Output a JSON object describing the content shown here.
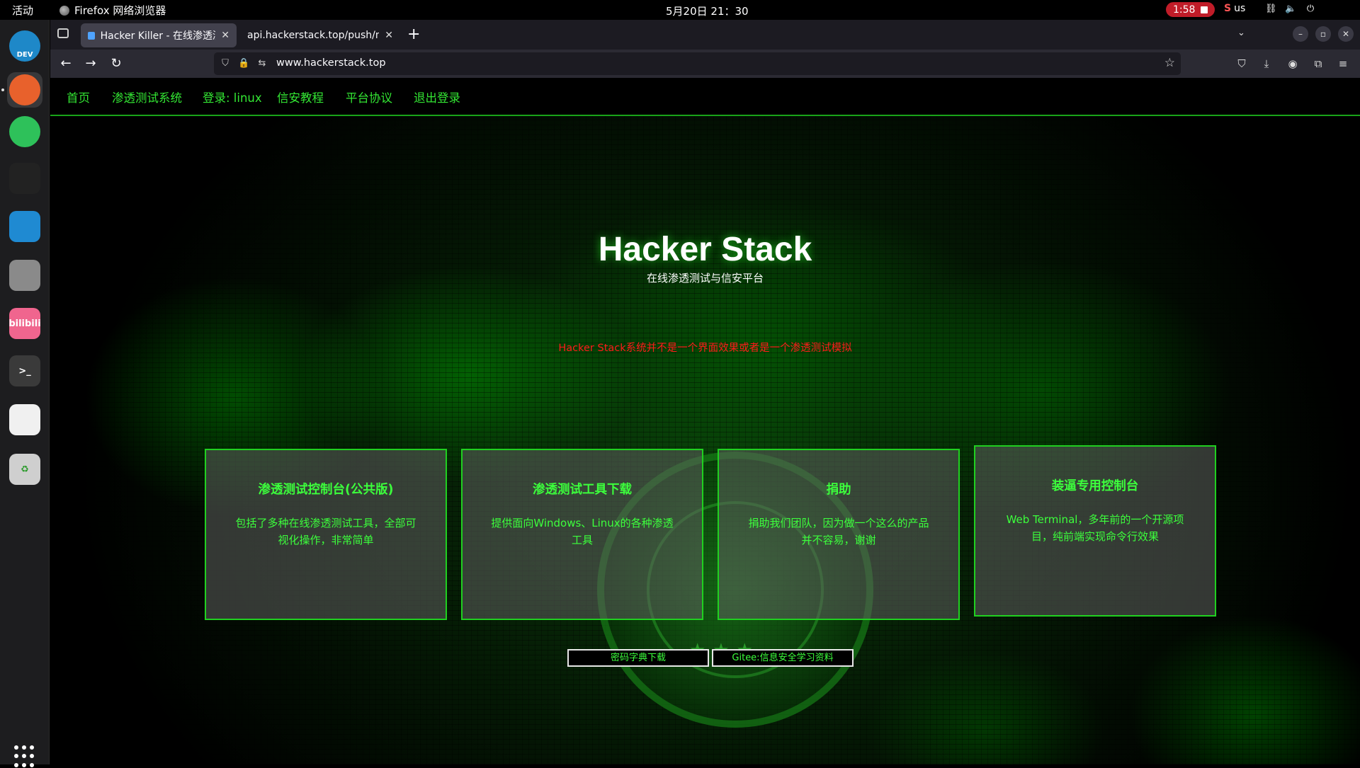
{
  "system": {
    "activities": "活动",
    "app_name": "Firefox 网络浏览器",
    "clock": "5月20日  21：30",
    "recording_time": "1:58",
    "input_method": "us"
  },
  "dock": {
    "items": [
      {
        "name": "edge-dev",
        "label": "DEV",
        "color": "#1e88c8"
      },
      {
        "name": "firefox",
        "label": "",
        "color": "#e8612c"
      },
      {
        "name": "wechat",
        "label": "",
        "color": "#2ec15a"
      },
      {
        "name": "qq",
        "label": "",
        "color": "#222"
      },
      {
        "name": "vscode",
        "label": "",
        "color": "#1f8ad2"
      },
      {
        "name": "files",
        "label": "",
        "color": "#8a8a8a"
      },
      {
        "name": "bilibili",
        "label": "bilibili",
        "color": "#f0658e"
      },
      {
        "name": "terminal",
        "label": ">_",
        "color": "#3a3a3a"
      },
      {
        "name": "pinwheel",
        "label": "",
        "color": "#f0f0f0"
      },
      {
        "name": "trash",
        "label": "♻",
        "color": "#cfcfcf"
      }
    ]
  },
  "browser": {
    "tabs": [
      {
        "title": "Hacker Killer - 在线渗透测试",
        "active": true
      },
      {
        "title": "api.hackerstack.top/push/mm",
        "active": false
      }
    ],
    "url": "www.hackerstack.top"
  },
  "site": {
    "nav": [
      "首页",
      "渗透测试系统",
      "登录: linux",
      "信安教程",
      "平台协议",
      "退出登录"
    ],
    "title": "Hacker Stack",
    "subtitle": "在线渗透测试与信安平台",
    "notice": "Hacker Stack系统并不是一个界面效果或者是一个渗透测试模拟",
    "cards": [
      {
        "title": "渗透测试控制台(公共版)",
        "desc": "包括了多种在线渗透测试工具，全部可视化操作，非常简单"
      },
      {
        "title": "渗透测试工具下载",
        "desc": "提供面向Windows、Linux的各种渗透工具"
      },
      {
        "title": "捐助",
        "desc": "捐助我们团队，因为做一个这么的产品并不容易，谢谢"
      },
      {
        "title": "装逼专用控制台",
        "desc": "Web Terminal，多年前的一个开源项目，纯前端实现命令行效果"
      }
    ],
    "buttons": [
      "密码字典下载",
      "Gitee:信息安全学习资料"
    ]
  }
}
